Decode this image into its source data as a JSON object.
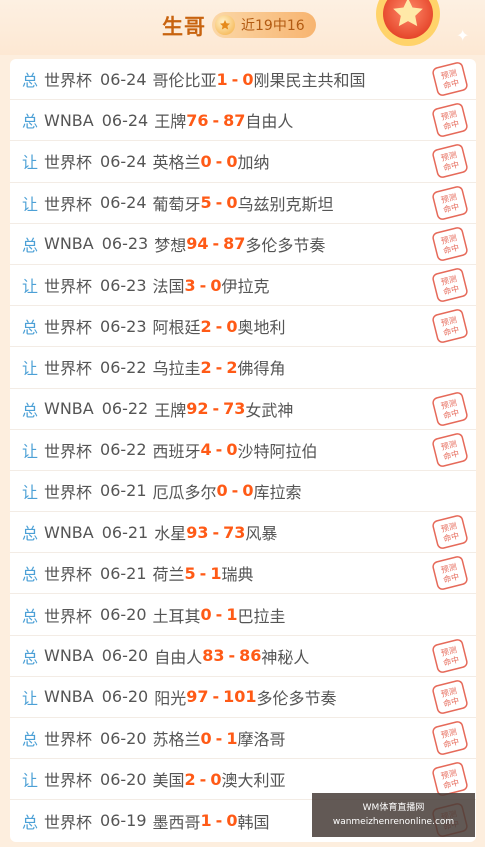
{
  "header": {
    "name": "生哥",
    "record": "近19中16"
  },
  "stamp_text": "预测命中",
  "watermark": {
    "line1": "WM体育直播网",
    "line2": "wanmeizhenrenonline.com"
  },
  "rows": [
    {
      "tag": "总",
      "league": "世界杯",
      "date": "06-24",
      "home": "哥伦比亚",
      "home_score": "1",
      "away_score": "0",
      "away": "刚果民主共和国",
      "hit": true
    },
    {
      "tag": "总",
      "league": "WNBA",
      "date": "06-24",
      "home": "王牌",
      "home_score": "76",
      "away_score": "87",
      "away": "自由人",
      "hit": true
    },
    {
      "tag": "让",
      "league": "世界杯",
      "date": "06-24",
      "home": "英格兰",
      "home_score": "0",
      "away_score": "0",
      "away": "加纳",
      "hit": true
    },
    {
      "tag": "让",
      "league": "世界杯",
      "date": "06-24",
      "home": "葡萄牙",
      "home_score": "5",
      "away_score": "0",
      "away": "乌兹别克斯坦",
      "hit": true
    },
    {
      "tag": "总",
      "league": "WNBA",
      "date": "06-23",
      "home": "梦想",
      "home_score": "94",
      "away_score": "87",
      "away": "多伦多节奏",
      "hit": true
    },
    {
      "tag": "让",
      "league": "世界杯",
      "date": "06-23",
      "home": "法国",
      "home_score": "3",
      "away_score": "0",
      "away": "伊拉克",
      "hit": true
    },
    {
      "tag": "总",
      "league": "世界杯",
      "date": "06-23",
      "home": "阿根廷",
      "home_score": "2",
      "away_score": "0",
      "away": "奥地利",
      "hit": true
    },
    {
      "tag": "让",
      "league": "世界杯",
      "date": "06-22",
      "home": "乌拉圭",
      "home_score": "2",
      "away_score": "2",
      "away": "佛得角",
      "hit": false
    },
    {
      "tag": "总",
      "league": "WNBA",
      "date": "06-22",
      "home": "王牌",
      "home_score": "92",
      "away_score": "73",
      "away": "女武神",
      "hit": true
    },
    {
      "tag": "让",
      "league": "世界杯",
      "date": "06-22",
      "home": "西班牙",
      "home_score": "4",
      "away_score": "0",
      "away": "沙特阿拉伯",
      "hit": true
    },
    {
      "tag": "让",
      "league": "世界杯",
      "date": "06-21",
      "home": "厄瓜多尔",
      "home_score": "0",
      "away_score": "0",
      "away": "库拉索",
      "hit": false
    },
    {
      "tag": "总",
      "league": "WNBA",
      "date": "06-21",
      "home": "水星",
      "home_score": "93",
      "away_score": "73",
      "away": "风暴",
      "hit": true
    },
    {
      "tag": "总",
      "league": "世界杯",
      "date": "06-21",
      "home": "荷兰",
      "home_score": "5",
      "away_score": "1",
      "away": "瑞典",
      "hit": true
    },
    {
      "tag": "总",
      "league": "世界杯",
      "date": "06-20",
      "home": "土耳其",
      "home_score": "0",
      "away_score": "1",
      "away": "巴拉圭",
      "hit": false
    },
    {
      "tag": "总",
      "league": "WNBA",
      "date": "06-20",
      "home": "自由人",
      "home_score": "83",
      "away_score": "86",
      "away": "神秘人",
      "hit": true
    },
    {
      "tag": "让",
      "league": "WNBA",
      "date": "06-20",
      "home": "阳光",
      "home_score": "97",
      "away_score": "101",
      "away": "多伦多节奏",
      "hit": true
    },
    {
      "tag": "总",
      "league": "世界杯",
      "date": "06-20",
      "home": "苏格兰",
      "home_score": "0",
      "away_score": "1",
      "away": "摩洛哥",
      "hit": true
    },
    {
      "tag": "让",
      "league": "世界杯",
      "date": "06-20",
      "home": "美国",
      "home_score": "2",
      "away_score": "0",
      "away": "澳大利亚",
      "hit": true
    },
    {
      "tag": "总",
      "league": "世界杯",
      "date": "06-19",
      "home": "墨西哥",
      "home_score": "1",
      "away_score": "0",
      "away": "韩国",
      "hit": true
    }
  ]
}
